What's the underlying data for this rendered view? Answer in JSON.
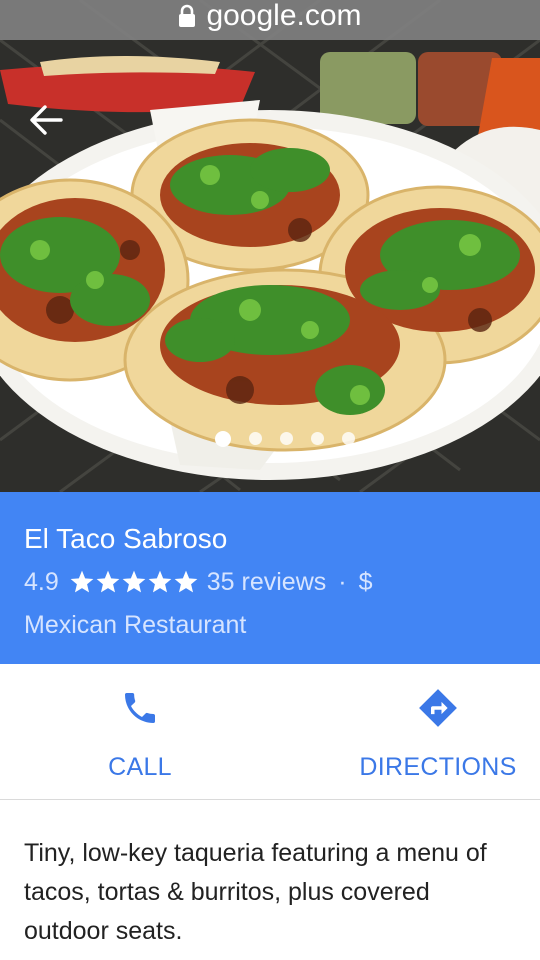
{
  "browser": {
    "url": "google.com"
  },
  "carousel": {
    "page_count": 5,
    "active_index": 0
  },
  "place": {
    "name": "El Taco Sabroso",
    "rating": "4.9",
    "stars": 5,
    "reviews": "35 reviews",
    "separator": "·",
    "price": "$",
    "category": "Mexican Restaurant"
  },
  "actions": {
    "call_label": "CALL",
    "directions_label": "DIRECTIONS"
  },
  "description": "Tiny, low-key taqueria featuring a menu of tacos, tortas & burritos, plus covered outdoor seats.",
  "colors": {
    "header_bg": "#4285f4",
    "action_blue": "#3b78e7",
    "urlbar_bg": "#808080"
  },
  "icons": {
    "lock": "lock-icon",
    "back": "arrow-left-icon",
    "star": "star-icon",
    "call": "phone-icon",
    "directions": "directions-icon"
  }
}
